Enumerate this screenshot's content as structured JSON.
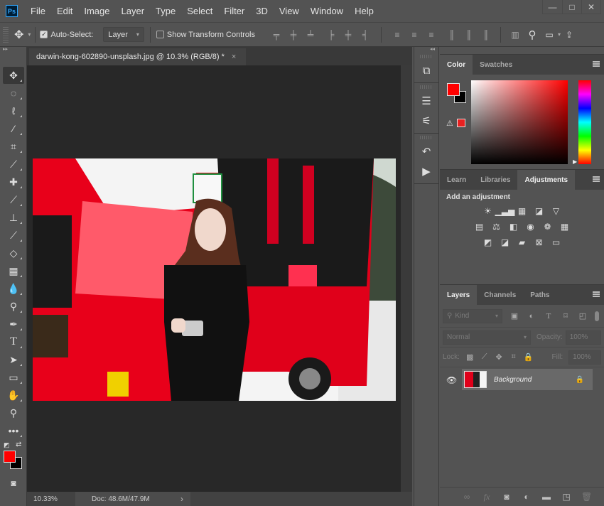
{
  "app": {
    "logo": "Ps"
  },
  "menu": [
    "File",
    "Edit",
    "Image",
    "Layer",
    "Type",
    "Select",
    "Filter",
    "3D",
    "View",
    "Window",
    "Help"
  ],
  "window_controls": {
    "minimize": "—",
    "maximize": "□",
    "close": "✕"
  },
  "options_bar": {
    "auto_select_label": "Auto-Select:",
    "auto_select_checked": true,
    "auto_select_target": "Layer",
    "show_transform_label": "Show Transform Controls",
    "show_transform_checked": false
  },
  "document": {
    "tab_title": "darwin-kong-602890-unsplash.jpg @ 10.3% (RGB/8) *",
    "close_glyph": "×"
  },
  "status": {
    "zoom": "10.33%",
    "doc_size": "Doc: 48.6M/47.9M",
    "arrow": "›"
  },
  "tools": [
    "move",
    "marquee",
    "lasso",
    "quick-select",
    "crop",
    "eyedropper",
    "healing",
    "brush",
    "clone-stamp",
    "history-brush",
    "eraser",
    "gradient",
    "blur",
    "dodge",
    "pen",
    "type",
    "path-select",
    "rectangle",
    "hand",
    "zoom",
    "more"
  ],
  "colors": {
    "foreground": "#ff0000",
    "background": "#000000",
    "out_of_gamut": "#e82020"
  },
  "color_panel": {
    "tabs": [
      "Color",
      "Swatches"
    ],
    "active": "Color"
  },
  "adjustments_panel": {
    "tabs": [
      "Learn",
      "Libraries",
      "Adjustments"
    ],
    "active": "Adjustments",
    "heading": "Add an adjustment",
    "rows": [
      [
        "brightness-contrast",
        "levels",
        "curves",
        "exposure",
        "vibrance"
      ],
      [
        "hue-saturation",
        "color-balance",
        "black-white",
        "photo-filter",
        "channel-mixer",
        "color-lookup"
      ],
      [
        "invert",
        "posterize",
        "threshold",
        "selective-color",
        "gradient-map"
      ]
    ]
  },
  "layers_panel": {
    "tabs": [
      "Layers",
      "Channels",
      "Paths"
    ],
    "active": "Layers",
    "filter_label": "Kind",
    "blend_mode": "Normal",
    "opacity_label": "Opacity:",
    "opacity": "100%",
    "lock_label": "Lock:",
    "fill_label": "Fill:",
    "fill": "100%",
    "layers": [
      {
        "name": "Background",
        "visible": true,
        "locked": true
      }
    ]
  }
}
